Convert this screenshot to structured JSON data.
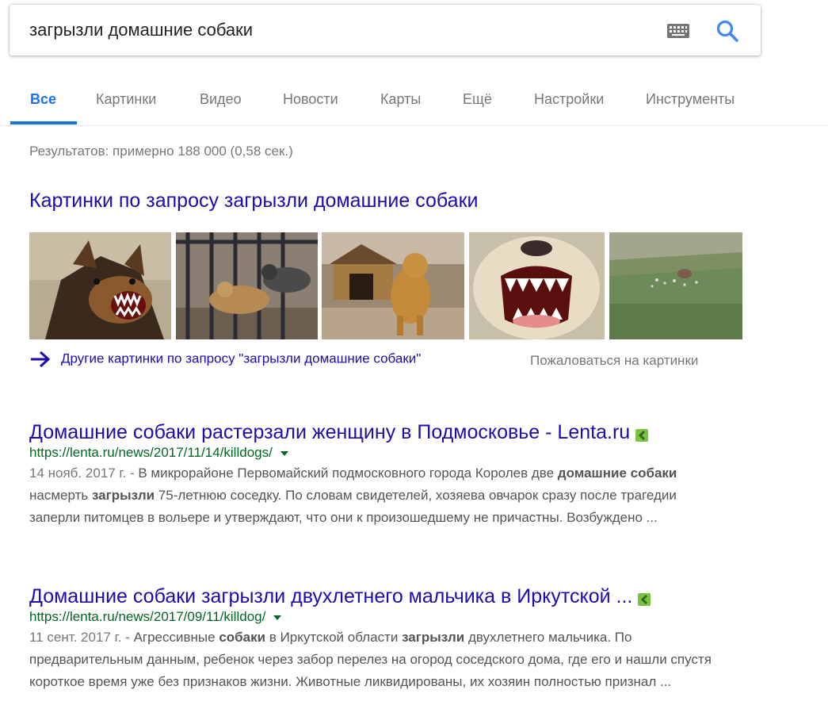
{
  "search": {
    "query": "загрызли домашние собаки",
    "keyboard_icon": "keyboard-icon",
    "search_icon": "search-icon"
  },
  "tabs": [
    {
      "label": "Все",
      "active": true
    },
    {
      "label": "Картинки"
    },
    {
      "label": "Видео"
    },
    {
      "label": "Новости"
    },
    {
      "label": "Карты"
    },
    {
      "label": "Ещё"
    },
    {
      "label": "Настройки"
    },
    {
      "label": "Инструменты"
    }
  ],
  "stats": "Результатов: примерно 188 000 (0,58 сек.)",
  "images": {
    "heading": "Картинки по запросу загрызли домашние собаки",
    "more_link": "Другие картинки по запросу \"загрызли домашние собаки\"",
    "report": "Пожаловаться на картинки"
  },
  "results": [
    {
      "title": "Домашние собаки растерзали женщину в Подмосковье - Lenta.ru",
      "url": "https://lenta.ru/news/2017/11/14/killdogs/",
      "date": "14 нояб. 2017 г. - ",
      "snippet_parts": [
        "В микрорайоне Первомайский подмосковного города Королев две ",
        "домашние собаки",
        " насмерть ",
        "загрызли",
        " 75-летнюю соседку. По словам свидетелей, хозяева овчарок сразу после трагедии заперли питомцев в вольере и утверждают, что они к произошедшему не причастны. Возбуждено ..."
      ]
    },
    {
      "title": "Домашние собаки загрызли двухлетнего мальчика в Иркутской ...",
      "url": "https://lenta.ru/news/2017/09/11/killdog/",
      "date": "11 сент. 2017 г. - ",
      "snippet_parts": [
        "Агрессивные ",
        "собаки",
        " в Иркутской области ",
        "загрызли",
        " двухлетнего мальчика. По предварительным данным, ребенок через забор перелез на огород соседского дома, где его и нашли спустя короткое время уже без признаков жизни. Животные ликвидированы, их хозяин полностью признал ..."
      ]
    }
  ],
  "colors": {
    "accent": "#1a73e8",
    "link": "#1a0dab",
    "url": "#006621",
    "amp": "#7cc142"
  }
}
